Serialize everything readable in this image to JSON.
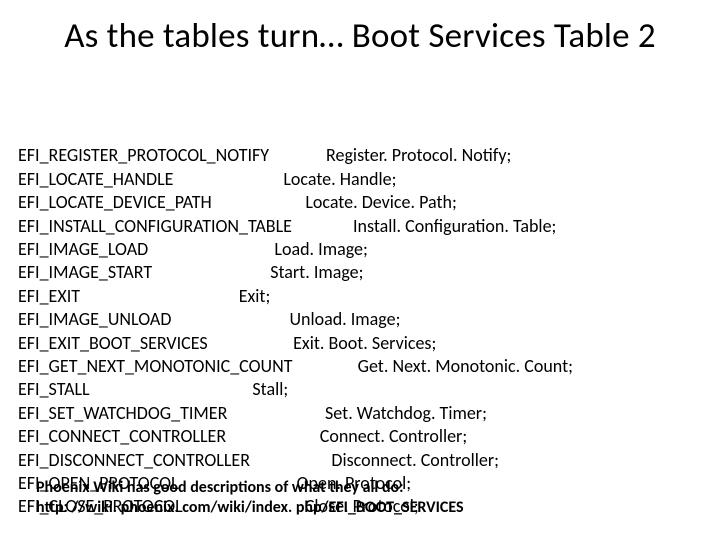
{
  "title": "As the tables turn… Boot Services Table 2",
  "rows": [
    {
      "type": "EFI_REGISTER_PROTOCOL_NOTIFY",
      "pad": "              ",
      "name": "Register. Protocol. Notify;"
    },
    {
      "type": "EFI_LOCATE_HANDLE",
      "pad": "                           ",
      "name": "Locate. Handle;"
    },
    {
      "type": "EFI_LOCATE_DEVICE_PATH",
      "pad": "                       ",
      "name": "Locate. Device. Path;"
    },
    {
      "type": "EFI_INSTALL_CONFIGURATION_TABLE",
      "pad": "               ",
      "name": "Install. Configuration. Table;"
    },
    {
      "type": "EFI_IMAGE_LOAD",
      "pad": "                               ",
      "name": "Load. Image;"
    },
    {
      "type": "EFI_IMAGE_START",
      "pad": "                             ",
      "name": "Start. Image;"
    },
    {
      "type": "EFI_EXIT",
      "pad": "                                       ",
      "name": "Exit;"
    },
    {
      "type": "EFI_IMAGE_UNLOAD",
      "pad": "                             ",
      "name": "Unload. Image;"
    },
    {
      "type": "EFI_EXIT_BOOT_SERVICES",
      "pad": "                     ",
      "name": "Exit. Boot. Services;"
    },
    {
      "type": "EFI_GET_NEXT_MONOTONIC_COUNT",
      "pad": "                ",
      "name": "Get. Next. Monotonic. Count;"
    },
    {
      "type": "EFI_STALL",
      "pad": "                                        ",
      "name": "Stall;"
    },
    {
      "type": "EFI_SET_WATCHDOG_TIMER",
      "pad": "                        ",
      "name": "Set. Watchdog. Timer;"
    },
    {
      "type": "EFI_CONNECT_CONTROLLER",
      "pad": "                       ",
      "name": "Connect. Controller;"
    },
    {
      "type": "EFI_DISCONNECT_CONTROLLER",
      "pad": "                    ",
      "name": "Disconnect. Controller;"
    },
    {
      "type": "EFI_OPEN_PROTOCOL",
      "pad": "                             ",
      "name": "Open. Protocol;"
    },
    {
      "type": "EFI_CLOSE_PROTOCOL",
      "pad": "                              ",
      "name": "Close. Protocol;"
    }
  ],
  "footer_line1": "Phoenix Wiki has good descriptions of what they all do:",
  "footer_line2": "http: //wiki. phoenix. com/wiki/index. php/EFI_BOOT_SERVICES"
}
